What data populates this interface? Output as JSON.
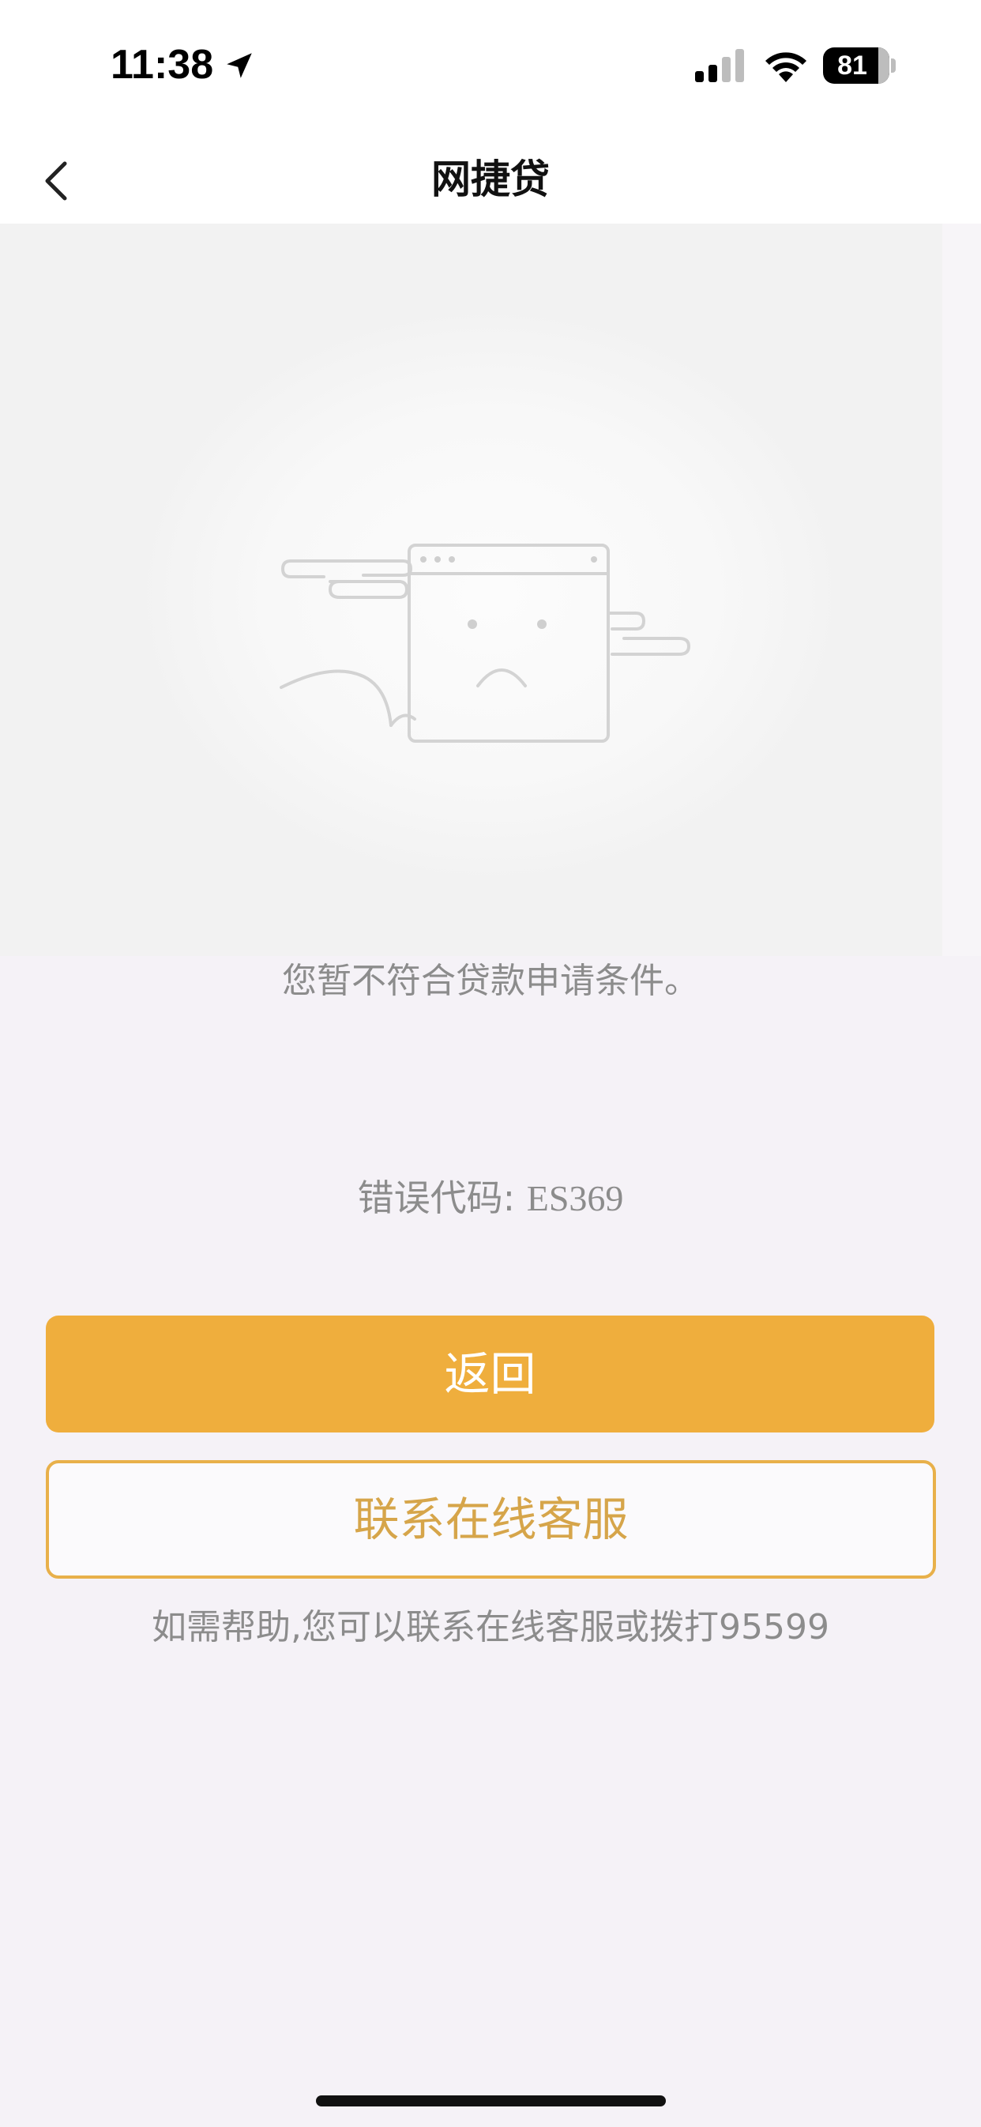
{
  "status_bar": {
    "time": "11:38",
    "battery_level": "81",
    "icons": [
      "location-arrow-icon",
      "signal-icon",
      "wifi-icon",
      "battery-icon"
    ]
  },
  "nav": {
    "title": "网捷贷",
    "back_icon": "chevron-left-icon"
  },
  "illustration": "sad-browser-window-icon",
  "content": {
    "message": "您暂不符合贷款申请条件。",
    "error_label": "错误代码: ",
    "error_code": "ES369"
  },
  "buttons": {
    "back_label": "返回",
    "contact_label": "联系在线客服"
  },
  "help": {
    "text": "如需帮助,您可以联系在线客服或拨打95599"
  },
  "colors": {
    "primary": "#efae3d",
    "outline": "#e8b04a",
    "background": "#f5f2f7"
  }
}
